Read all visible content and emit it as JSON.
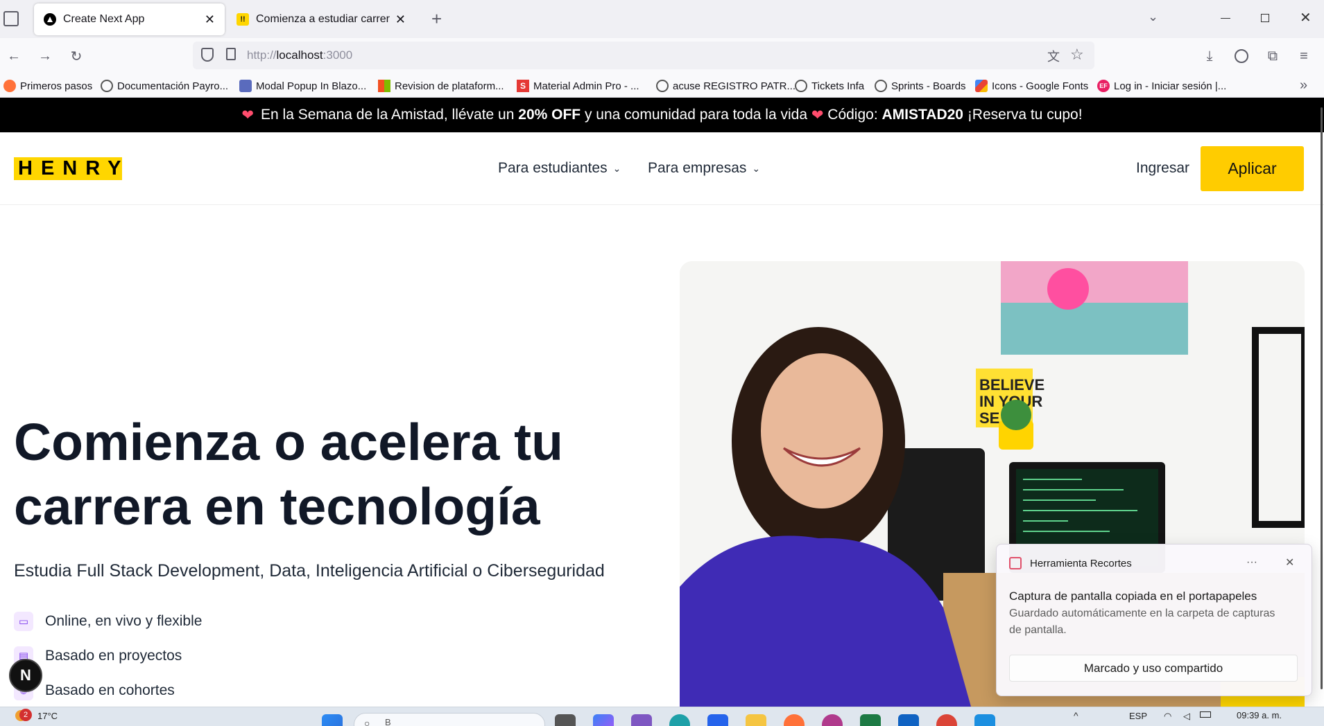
{
  "browser": {
    "tabs": [
      {
        "label": "Create Next App",
        "active": true
      },
      {
        "label": "Comienza a estudiar carreras en",
        "active": false
      }
    ],
    "url_protocol": "http://",
    "url_host": "localhost",
    "url_port": ":3000",
    "bookmarks": [
      "Primeros pasos",
      "Documentación Payro...",
      "Modal Popup In Blazo...",
      "Revision de plataform...",
      "Material Admin Pro - ...",
      "acuse REGISTRO PATR...",
      "Tickets Infa",
      "Sprints - Boards",
      "Icons - Google Fonts",
      "Log in - Iniciar sesión |..."
    ]
  },
  "promo": {
    "part1": "En la Semana de la Amistad, llévate un ",
    "bold1": "20% OFF",
    "part2": " y una comunidad para toda la vida ",
    "part3": " Código: ",
    "bold2": "AMISTAD20",
    "part4": " ¡Reserva tu cupo!"
  },
  "header": {
    "logo": "HENRY",
    "nav": [
      "Para estudiantes",
      "Para empresas"
    ],
    "login": "Ingresar",
    "apply": "Aplicar"
  },
  "hero": {
    "title": "Comienza o acelera tu carrera en tecnología",
    "subtitle": "Estudia Full Stack Development, Data, Inteligencia Artificial o Ciberseguridad",
    "features": [
      "Online, en vivo y flexible",
      "Basado en proyectos",
      "Basado en cohortes"
    ],
    "image_sign_line1": "BELIEVE",
    "image_sign_line2": "IN YOUR",
    "image_sign_line3": "SE"
  },
  "next_badge": "N",
  "toast": {
    "app": "Herramienta Recortes",
    "title": "Captura de pantalla copiada en el portapapeles",
    "body": "Guardado automáticamente en la carpeta de capturas de pantalla.",
    "action": "Marcado y uso compartido",
    "more": "···"
  },
  "taskbar": {
    "weather_badge": "2",
    "temperature": "17°C",
    "search_placeholder": "B",
    "language": "ESP",
    "time": "09:39 a. m."
  },
  "colors": {
    "brand_yellow": "#ffd600",
    "apply_button": "#ffcc00",
    "promo_bg": "#000000"
  }
}
